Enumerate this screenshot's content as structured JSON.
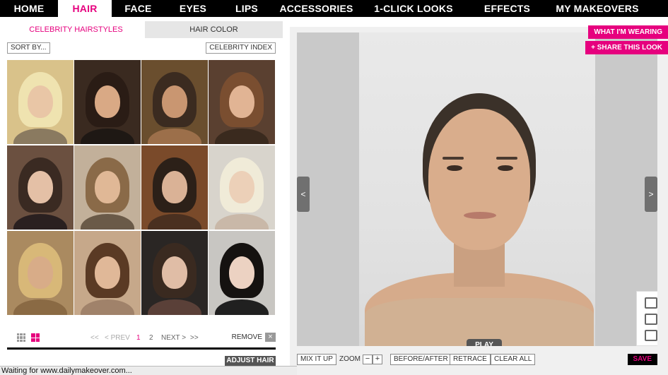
{
  "nav": {
    "items": [
      {
        "label": "HOME"
      },
      {
        "label": "HAIR",
        "active": true
      },
      {
        "label": "FACE"
      },
      {
        "label": "EYES"
      },
      {
        "label": "LIPS"
      },
      {
        "label": "ACCESSORIES"
      },
      {
        "label": "1-CLICK LOOKS"
      },
      {
        "label": "EFFECTS"
      },
      {
        "label": "MY MAKEOVERS"
      }
    ]
  },
  "left": {
    "tabs": [
      {
        "label": "CELEBRITY HAIRSTYLES",
        "active": true
      },
      {
        "label": "HAIR COLOR",
        "active": false
      }
    ],
    "sort_label": "SORT BY...",
    "index_label": "CELEBRITY INDEX",
    "thumbnails": [
      {
        "hair": "#efe3b0",
        "skin": "#e9c6a6",
        "bg": "#d9c28a",
        "top": "#8a7a60"
      },
      {
        "hair": "#2a1c15",
        "skin": "#d9a985",
        "bg": "#3a2a20",
        "top": "#1e1814"
      },
      {
        "hair": "#3b2b20",
        "skin": "#c99671",
        "bg": "#6a4e2e",
        "top": "#9c6f4a"
      },
      {
        "hair": "#7a4e30",
        "skin": "#e1b494",
        "bg": "#5a4030",
        "top": "#3a2a1e"
      },
      {
        "hair": "#3a2a22",
        "skin": "#e4c0a6",
        "bg": "#6b5040",
        "top": "#2a2020"
      },
      {
        "hair": "#8a6a48",
        "skin": "#e0b896",
        "bg": "#c2b09a",
        "top": "#6a5a48"
      },
      {
        "hair": "#2c2018",
        "skin": "#dab296",
        "bg": "#7a4a2a",
        "top": "#4a3020"
      },
      {
        "hair": "#f0ebd8",
        "skin": "#ecd0b8",
        "bg": "#d8d4cc",
        "top": "#c9b8a8"
      },
      {
        "hair": "#d8b878",
        "skin": "#d8ac88",
        "bg": "#aa8a60",
        "top": "#8a6a44"
      },
      {
        "hair": "#5a3a24",
        "skin": "#e0b898",
        "bg": "#c6a88a",
        "top": "#a0826a"
      },
      {
        "hair": "#3a2a20",
        "skin": "#e0bda6",
        "bg": "#2a2624",
        "top": "#5a4038"
      },
      {
        "hair": "#151210",
        "skin": "#ecd2c2",
        "bg": "#c8c6c2",
        "top": "#202020"
      }
    ],
    "pager": {
      "prev_first": "<<",
      "prev": "< PREV",
      "page1": "1",
      "page2": "2",
      "next": "NEXT >",
      "next_last": ">>"
    },
    "remove_label": "REMOVE",
    "remove_icon": "×",
    "adjust_hair_label": "ADJUST HAIR",
    "accent_color": "#e6007e"
  },
  "right": {
    "what_wearing_label": "WHAT I'M WEARING",
    "share_label": "+ SHARE THIS LOOK",
    "prev_arrow": "<",
    "next_arrow": ">",
    "play_label": "PLAY",
    "toolbar": {
      "mix_label": "MIX IT UP",
      "zoom_label": "ZOOM",
      "zoom_out": "−",
      "zoom_in": "+",
      "before_after_label": "BEFORE/AFTER",
      "retrace_label": "RETRACE",
      "clear_label": "CLEAR ALL",
      "save_label": "SAVE"
    }
  },
  "status": {
    "text": "Waiting for www.dailymakeover.com..."
  }
}
